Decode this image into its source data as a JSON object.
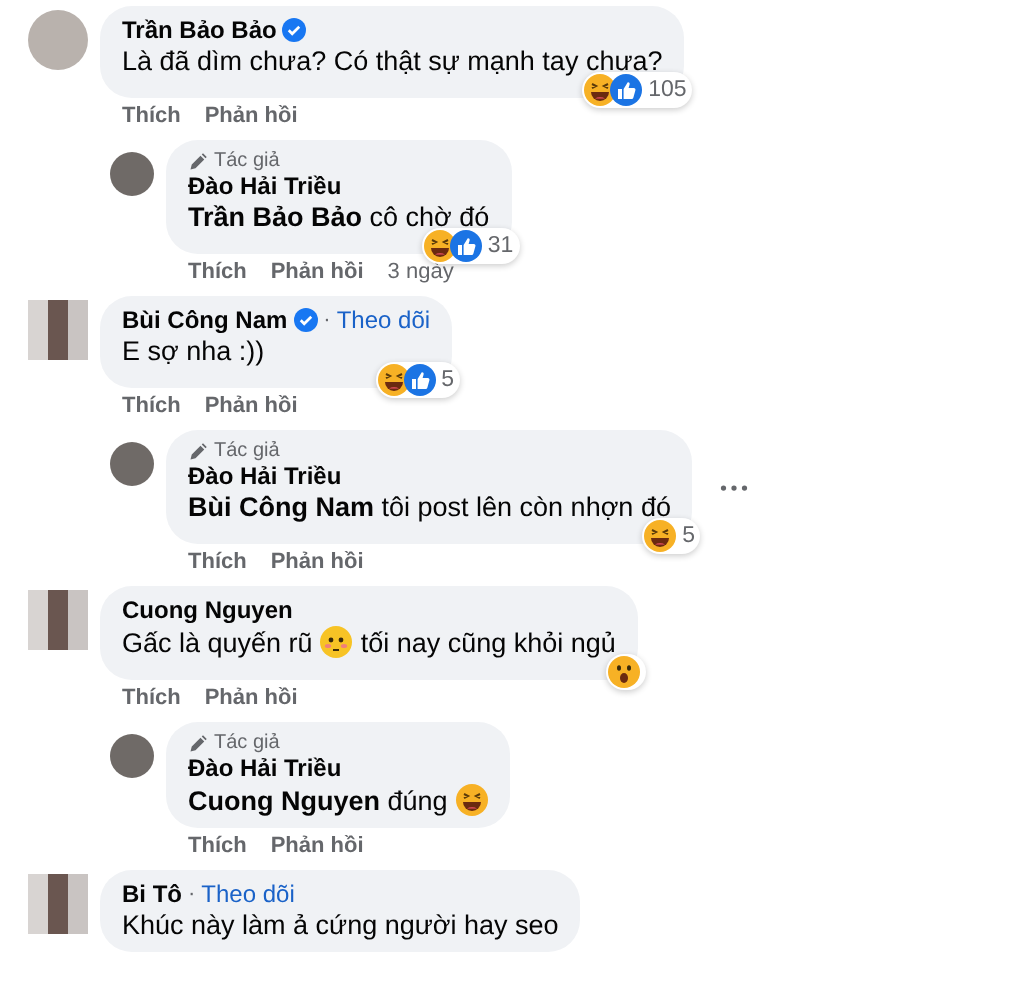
{
  "comments": [
    {
      "avatar": {
        "kind": "photo"
      },
      "author": "Trần Bảo Bảo",
      "verified": true,
      "segments": [
        {
          "kind": "text",
          "text": "Là đã dìm chưa? Có thật sự mạnh tay chưa?"
        }
      ],
      "reactions": {
        "items": [
          {
            "kind": "laugh"
          },
          {
            "kind": "like"
          }
        ],
        "count": "105"
      },
      "actions": [
        "Thích",
        "Phản hồi"
      ],
      "replies": [
        {
          "avatar": {
            "kind": "photo"
          },
          "badge": "Tác giả",
          "author": "Đào Hải Triều",
          "segments": [
            {
              "kind": "text",
              "text": "**Trần Bảo Bảo** cô chờ đó"
            }
          ],
          "reactions": {
            "items": [
              {
                "kind": "laugh"
              },
              {
                "kind": "like"
              }
            ],
            "count": "31"
          },
          "actions": [
            "Thích",
            "Phản hồi"
          ],
          "time": "3 ngày"
        }
      ]
    },
    {
      "avatar": {
        "kind": "mosaic"
      },
      "author": "Bùi Công Nam",
      "verified": true,
      "separator": "·",
      "follow": "Theo dõi",
      "segments": [
        {
          "kind": "text",
          "text": "E sợ nha :))"
        }
      ],
      "reactions": {
        "items": [
          {
            "kind": "laugh"
          },
          {
            "kind": "like"
          }
        ],
        "count": "5"
      },
      "actions": [
        "Thích",
        "Phản hồi"
      ],
      "replies": [
        {
          "avatar": {
            "kind": "photo"
          },
          "badge": "Tác giả",
          "author": "Đào Hải Triều",
          "more": true,
          "segments": [
            {
              "kind": "text",
              "text": "**Bùi Công Nam** tôi post lên còn nhợn đó"
            }
          ],
          "reactions": {
            "items": [
              {
                "kind": "laugh"
              }
            ],
            "count": "5"
          },
          "actions": [
            "Thích",
            "Phản hồi"
          ]
        }
      ]
    },
    {
      "avatar": {
        "kind": "mosaic"
      },
      "author": "Cuong Nguyen",
      "segments": [
        {
          "kind": "text",
          "text": "Gấc là quyến rũ"
        },
        {
          "kind": "flushed"
        },
        {
          "kind": "text",
          "text": "tối nay cũng khỏi ngủ"
        }
      ],
      "reactions": {
        "items": [
          {
            "kind": "wow"
          }
        ]
      },
      "actions": [
        "Thích",
        "Phản hồi"
      ],
      "replies": [
        {
          "avatar": {
            "kind": "photo"
          },
          "badge": "Tác giả",
          "author": "Đào Hải Triều",
          "segments": [
            {
              "kind": "text",
              "text": "**Cuong Nguyen** đúng"
            },
            {
              "kind": "laugh"
            }
          ],
          "actions": [
            "Thích",
            "Phản hồi"
          ]
        }
      ]
    },
    {
      "avatar": {
        "kind": "mosaic"
      },
      "author": "Bi Tô",
      "separator": "·",
      "follow": "Theo dõi",
      "segments": [
        {
          "kind": "text",
          "text": "Khúc này làm ả cứng người hay seo"
        }
      ]
    }
  ]
}
